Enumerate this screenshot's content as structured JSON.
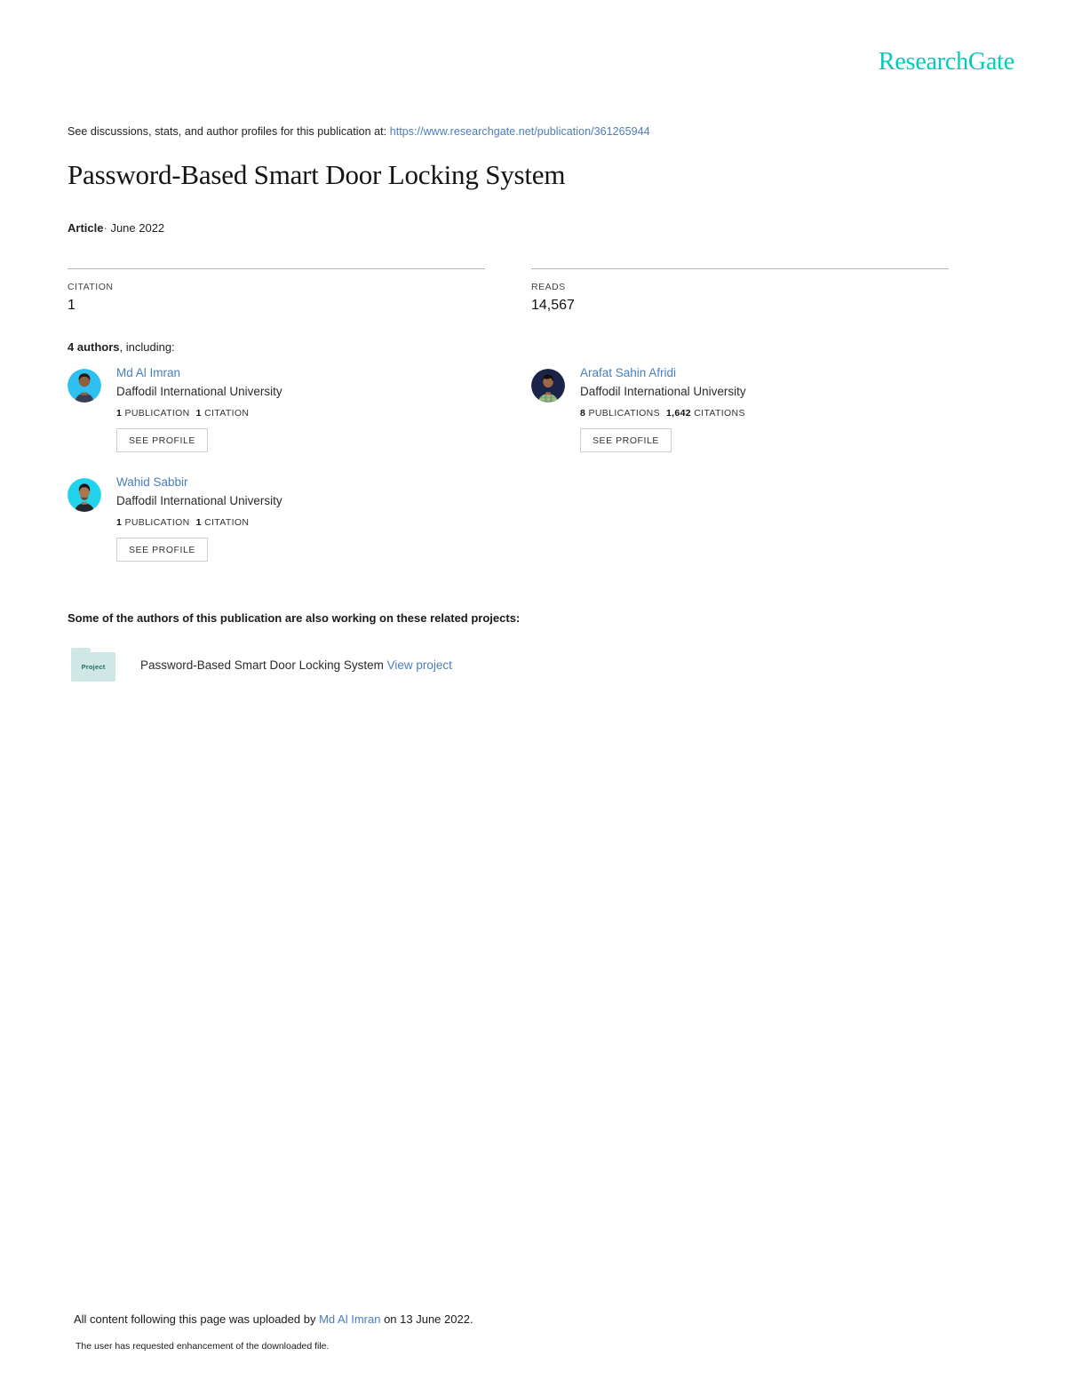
{
  "brand": {
    "logo_text": "ResearchGate",
    "logo_color": "#00ccbb"
  },
  "header": {
    "discussion_prefix": "See discussions, stats, and author profiles for this publication at:",
    "publication_url": "https://www.researchgate.net/publication/361265944"
  },
  "publication": {
    "title": "Password-Based Smart Door Locking System",
    "type": "Article",
    "separator": "·",
    "date": "June 2022"
  },
  "stats": [
    {
      "label": "CITATION",
      "value": "1"
    },
    {
      "label": "READS",
      "value": "14,567"
    }
  ],
  "authors_section": {
    "count_text": "4 authors",
    "suffix_text": ", including:",
    "see_profile_label": "SEE PROFILE"
  },
  "authors": [
    {
      "name": "Md Al Imran",
      "affiliation": "Daffodil International University",
      "publications_count": "1",
      "publications_label": "PUBLICATION",
      "citations_count": "1",
      "citations_label": "CITATION",
      "see_profile_label": "SEE PROFILE",
      "avatar_name": "avatar-md-al-imran"
    },
    {
      "name": "Arafat Sahin Afridi",
      "affiliation": "Daffodil International University",
      "publications_count": "8",
      "publications_label": "PUBLICATIONS",
      "citations_count": "1,642",
      "citations_label": "CITATIONS",
      "see_profile_label": "SEE PROFILE",
      "avatar_name": "avatar-arafat-sahin-afridi"
    },
    {
      "name": "Wahid Sabbir",
      "affiliation": "Daffodil International University",
      "publications_count": "1",
      "publications_label": "PUBLICATION",
      "citations_count": "1",
      "citations_label": "CITATION",
      "see_profile_label": "SEE PROFILE",
      "avatar_name": "avatar-wahid-sabbir"
    }
  ],
  "projects": {
    "heading": "Some of the authors of this publication are also working on these related projects:",
    "folder_label": "Project",
    "item_title": "Password-Based Smart Door Locking System",
    "view_link_label": "View project"
  },
  "footer": {
    "upload_prefix": "All content following this page was uploaded by",
    "uploader_name": "Md Al Imran",
    "upload_suffix": "on 13 June 2022.",
    "note": "The user has requested enhancement of the downloaded file."
  },
  "colors": {
    "link_blue": "#4a7ebb",
    "brand_teal": "#00ccbb",
    "folder_teal": "#cfe8e5"
  }
}
